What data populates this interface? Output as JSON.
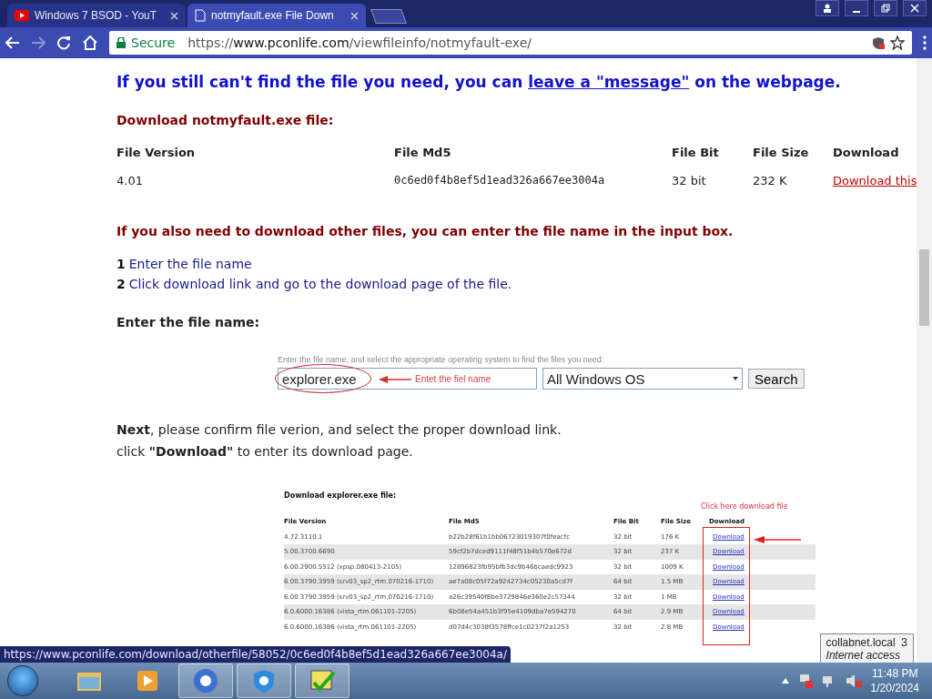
{
  "tabs": [
    {
      "title": "Windows 7 BSOD - YouT",
      "kind": "video",
      "selected": false
    },
    {
      "title": "notmyfault.exe File Down",
      "kind": "page",
      "selected": true
    }
  ],
  "address": {
    "secure_label": "Secure",
    "scheme": "https://",
    "host": "www.pconlife.com",
    "path": "/viewfileinfo/notmyfault-exe/"
  },
  "page": {
    "notice": {
      "before": "If you still can't find the file you need, you can ",
      "link": "leave a \"message\"",
      "after": " on the webpage."
    },
    "download_title": "Download notmyfault.exe file:",
    "file_table": {
      "columns": [
        "File Version",
        "File Md5",
        "File Bit",
        "File Size",
        "Download"
      ],
      "row": [
        "4.01",
        "0c6ed0f4b8ef5d1ead326a667ee3004a",
        "32 bit",
        "232 K",
        "Download this"
      ]
    },
    "other_title": "If you also need to download other files, you can enter the file name in the input box.",
    "steps": [
      {
        "number": "1",
        "text": "Enter the file name"
      },
      {
        "number": "2",
        "text": "Click download link and go to the download page of the file."
      }
    ],
    "enter_label": "Enter the file name:",
    "example_form": {
      "hint": "Enter the file name, and select the appropriate operating system to find the files you need:",
      "value": "explorer.exe",
      "annotation": "Entet the fiel name",
      "os": "All Windows OS",
      "button": "Search"
    },
    "next_line": "**Next**, please confirm file verion, and select the proper download link.",
    "click_line": "click **\"Download\"** to enter its download page.",
    "example_table": {
      "title": "Download explorer.exe file:",
      "annotation": "Click here download file",
      "columns": [
        "File Version",
        "File Md5",
        "File Bit",
        "File Size",
        "Download"
      ],
      "rows": [
        [
          "4.72.3110.1",
          "b22b28f61b1bb06723019307f0feacfc",
          "32 bit",
          "176 K",
          "Download"
        ],
        [
          "5.00.3700.6690",
          "59cf2b7dced9111f48f51b4b570e672d",
          "32 bit",
          "237 K",
          "Download"
        ],
        [
          "6.00.2900.5512 (xpsp.080413-2105)",
          "12896823fb95bfb3dc9b46bcaedc9923",
          "32 bit",
          "1009 K",
          "Download"
        ],
        [
          "6.00.3790.3959 (srv03_sp2_rtm.070216-1710)",
          "ae7a08c05f72a9242734c05230a5cd7f",
          "64 bit",
          "1.5 MB",
          "Download"
        ],
        [
          "6.00.3790.3959 (srv03_sp2_rtm.070216-1710)",
          "a26c39540f8be3729846e360e2c57344",
          "32 bit",
          "1 MB",
          "Download"
        ],
        [
          "6.0.6000.16386 (vista_rtm.061101-2205)",
          "6b08e54a451b3f95e4109dba7e594270",
          "64 bit",
          "2.9 MB",
          "Download"
        ],
        [
          "6.0.6000.16386 (vista_rtm.061101-2205)",
          "d07d4c3038f3578ffce1c0237f2a1253",
          "32 bit",
          "2.8 MB",
          "Download"
        ]
      ]
    }
  },
  "status_url": "https://www.pconlife.com/download/otherfile/58052/0c6ed0f4b8ef5d1ead326a667ee3004a/",
  "tooltip": {
    "title": "collabnet.local",
    "count": "3",
    "subtitle": "Internet access"
  },
  "taskbar": {
    "apps": [
      {
        "kind": "folder",
        "selected": false
      },
      {
        "kind": "media",
        "selected": false
      },
      {
        "kind": "chrome",
        "selected": true
      },
      {
        "kind": "shield",
        "selected": true
      },
      {
        "kind": "check",
        "selected": true
      }
    ],
    "time": "11:48 PM",
    "date": "1/20/2024"
  }
}
